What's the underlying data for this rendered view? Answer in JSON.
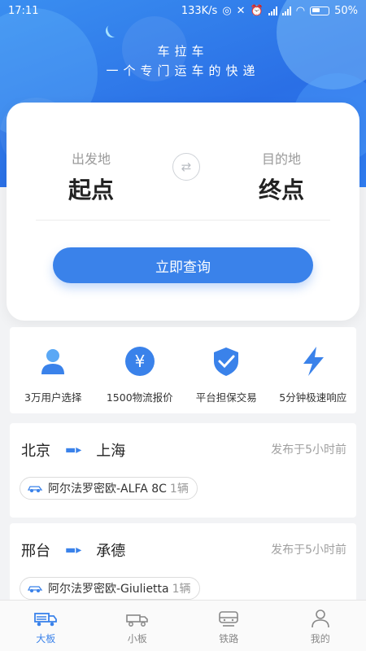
{
  "status_bar": {
    "time": "17:11",
    "net_speed": "133K/s",
    "battery": "50%"
  },
  "header": {
    "title": "车拉车",
    "slogan": "一个专门运车的快递"
  },
  "query": {
    "from_label": "出发地",
    "from_value": "起点",
    "to_label": "目的地",
    "to_value": "终点",
    "swap_icon": "swap-arrows-icon",
    "button": "立即查询"
  },
  "features": [
    {
      "icon": "user-icon",
      "label": "3万用户选择"
    },
    {
      "icon": "yuan-icon",
      "label": "1500物流报价"
    },
    {
      "icon": "shield-check-icon",
      "label": "平台担保交易"
    },
    {
      "icon": "lightning-icon",
      "label": "5分钟极速响应"
    }
  ],
  "listings": [
    {
      "from": "北京",
      "to": "上海",
      "posted": "发布于5小时前",
      "car": "阿尔法罗密欧-ALFA 8C",
      "qty": "1辆"
    },
    {
      "from": "邢台",
      "to": "承德",
      "posted": "发布于5小时前",
      "car": "阿尔法罗密欧-Giulietta",
      "qty": "1辆"
    }
  ],
  "tabs": [
    {
      "label": "大板",
      "icon": "truck-large-icon",
      "active": true
    },
    {
      "label": "小板",
      "icon": "truck-small-icon",
      "active": false
    },
    {
      "label": "铁路",
      "icon": "train-icon",
      "active": false
    },
    {
      "label": "我的",
      "icon": "person-icon",
      "active": false
    }
  ],
  "colors": {
    "accent": "#3a82ea",
    "hero": "#2a6fe6"
  }
}
